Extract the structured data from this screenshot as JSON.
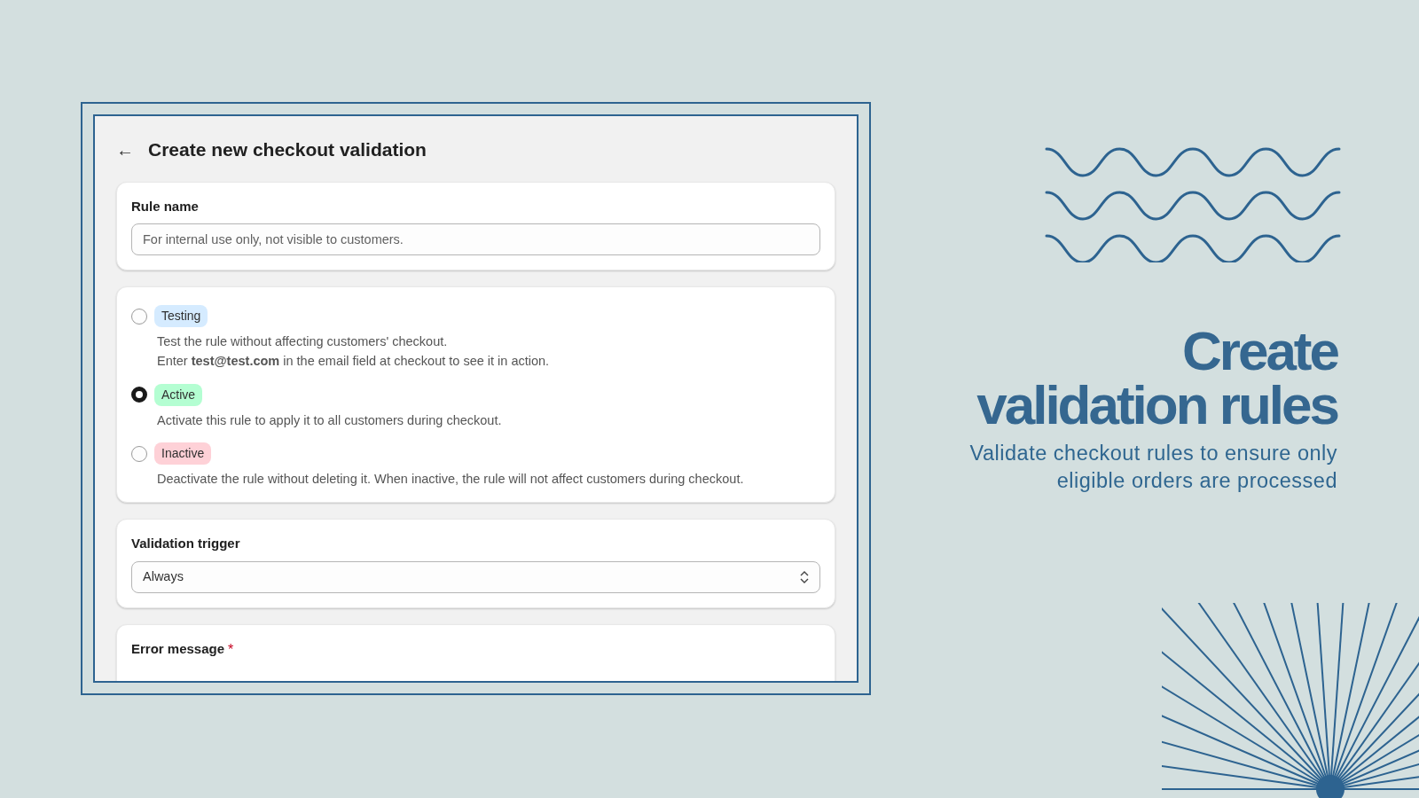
{
  "screen": {
    "back_icon": "←",
    "title": "Create new checkout validation",
    "rule_name": {
      "label": "Rule name",
      "placeholder": "For internal use only, not visible to customers."
    },
    "status_options": [
      {
        "label": "Testing",
        "color": "#d5ebff",
        "selected": false,
        "description": [
          "Test the rule without affecting customers' checkout.",
          "Enter **test@test.com** in the email field at checkout to see it in action."
        ]
      },
      {
        "label": "Active",
        "color": "#b4fed2",
        "selected": true,
        "description": [
          "Activate this rule to apply it to all customers during checkout."
        ]
      },
      {
        "label": "Inactive",
        "color": "#fed1d7",
        "selected": false,
        "description": [
          "Deactivate the rule without deleting it. When inactive, the rule will not affect customers during checkout."
        ]
      }
    ],
    "validation_trigger": {
      "label": "Validation trigger",
      "value": "Always"
    },
    "error_message": {
      "label": "Error message",
      "required_mark": "*"
    }
  },
  "promo": {
    "headline_lines": [
      "Create",
      "validation rules"
    ],
    "subtitle": "Validate checkout rules to ensure only eligible orders are processed"
  }
}
